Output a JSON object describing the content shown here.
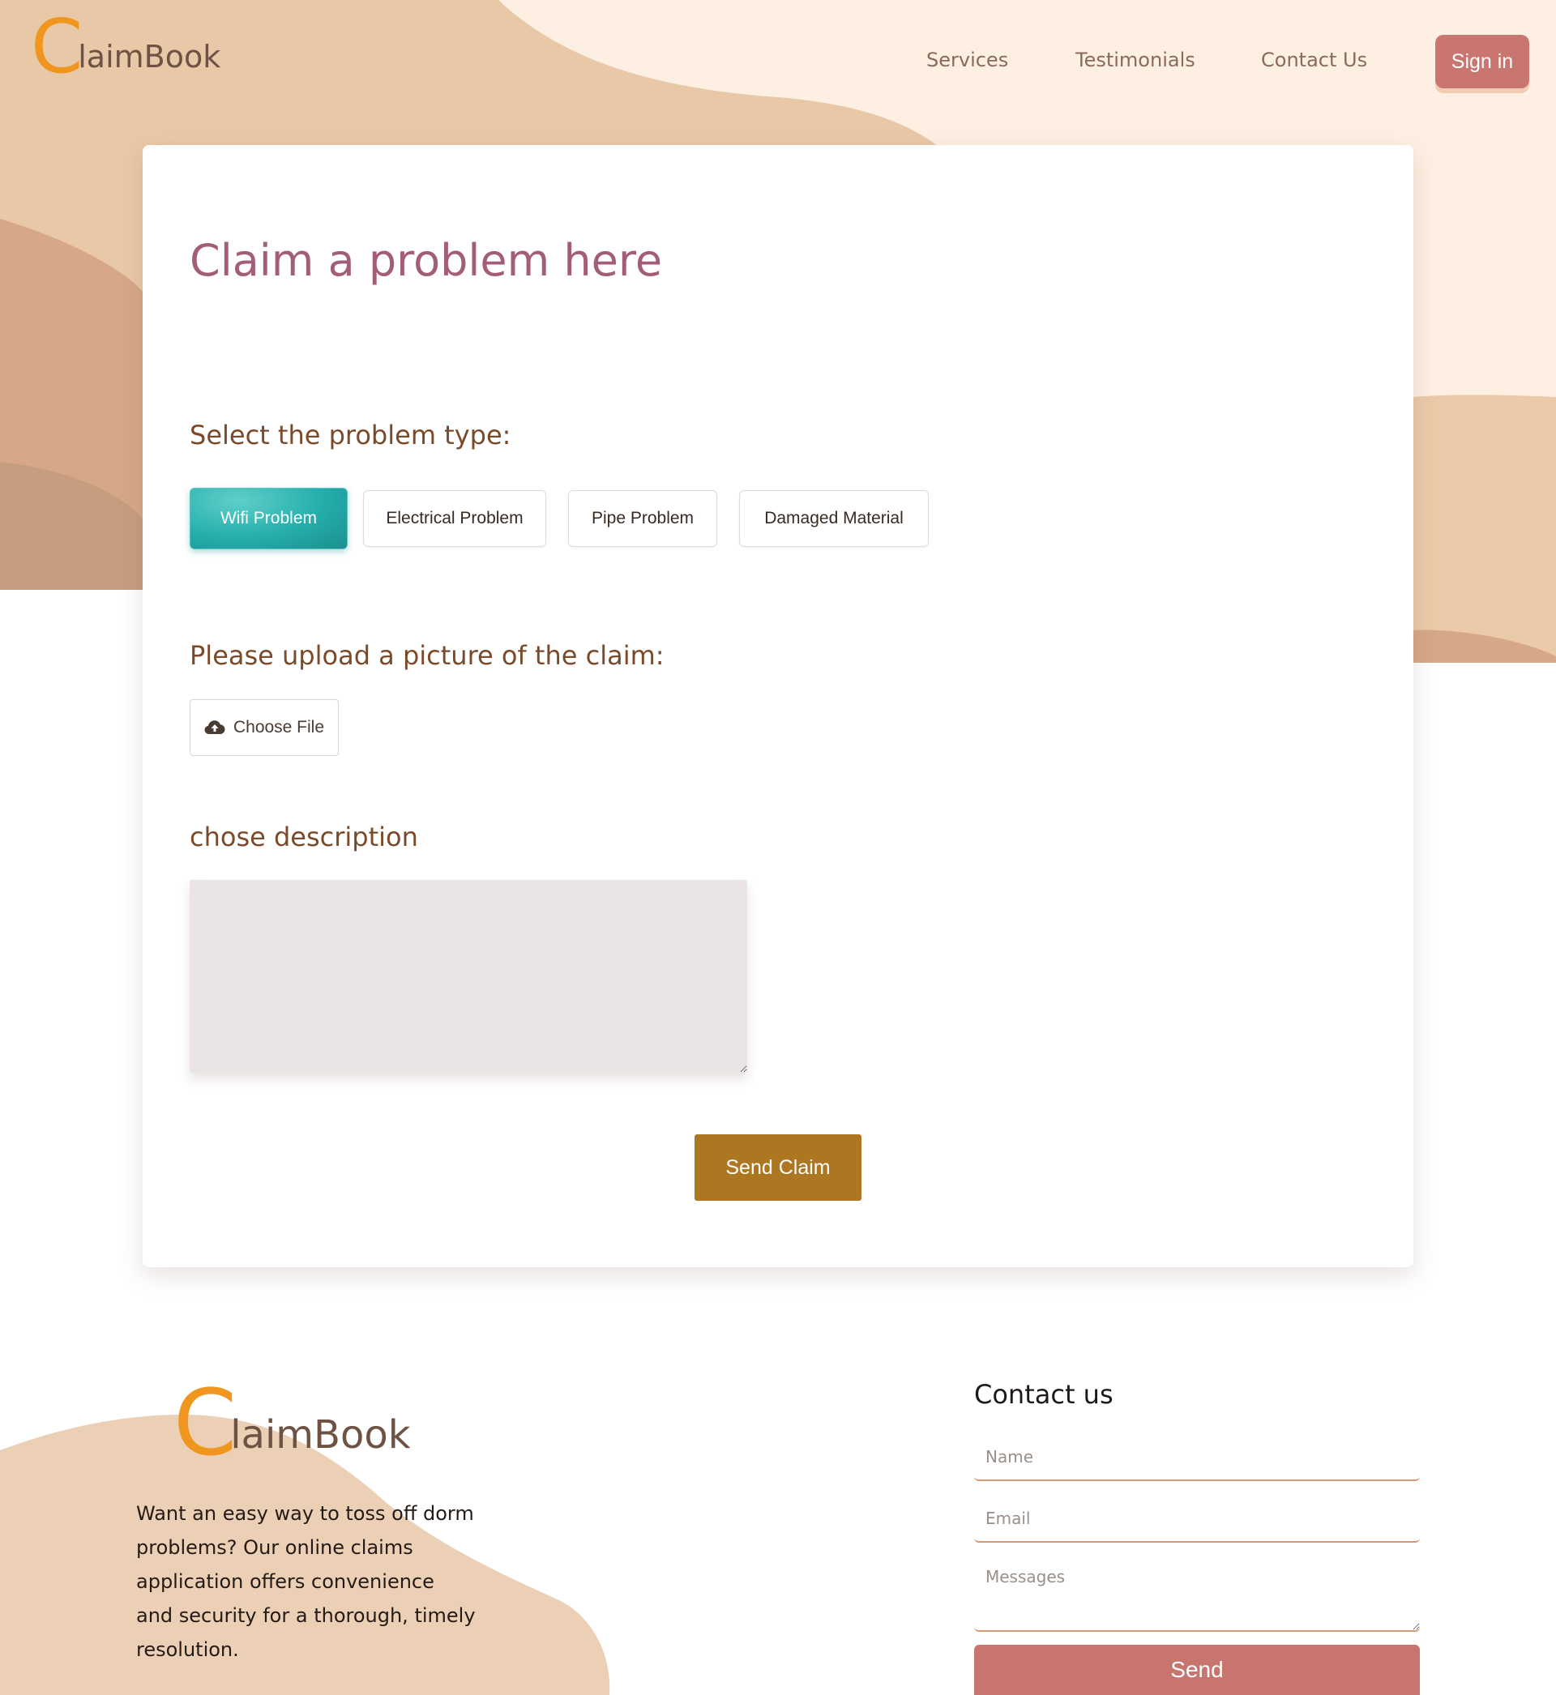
{
  "brand": {
    "initial": "C",
    "rest": "laimBook"
  },
  "nav": {
    "services": "Services",
    "testimonials": "Testimonials",
    "contact": "Contact Us",
    "signin": "Sign in"
  },
  "claim": {
    "title": "Claim a problem here",
    "problem_type_label": "Select the problem type:",
    "problem_types": [
      "Wifi Problem",
      "Electrical Problem",
      "Pipe Problem",
      "Damaged Material"
    ],
    "selected_type": "Wifi Problem",
    "upload_label": "Please upload a picture of the claim:",
    "choose_file": "Choose File",
    "description_label": "chose description",
    "description_value": "",
    "submit": "Send Claim"
  },
  "footer": {
    "description": "Want an easy way to toss off dorm problems? Our online claims application offers convenience and security for a thorough, timely resolution.",
    "contact_title": "Contact us",
    "name_placeholder": "Name",
    "email_placeholder": "Email",
    "messages_placeholder": "Messages",
    "send": "Send"
  },
  "colors": {
    "accent_teal": "#25aeac",
    "brand_orange": "#f0961f",
    "title_mauve": "#a25d78",
    "submit_gold": "#ad7621",
    "signin_rose": "#c97670",
    "peach_background": "#fdf0e2"
  },
  "icons": {
    "upload": "cloud-upload-icon"
  }
}
